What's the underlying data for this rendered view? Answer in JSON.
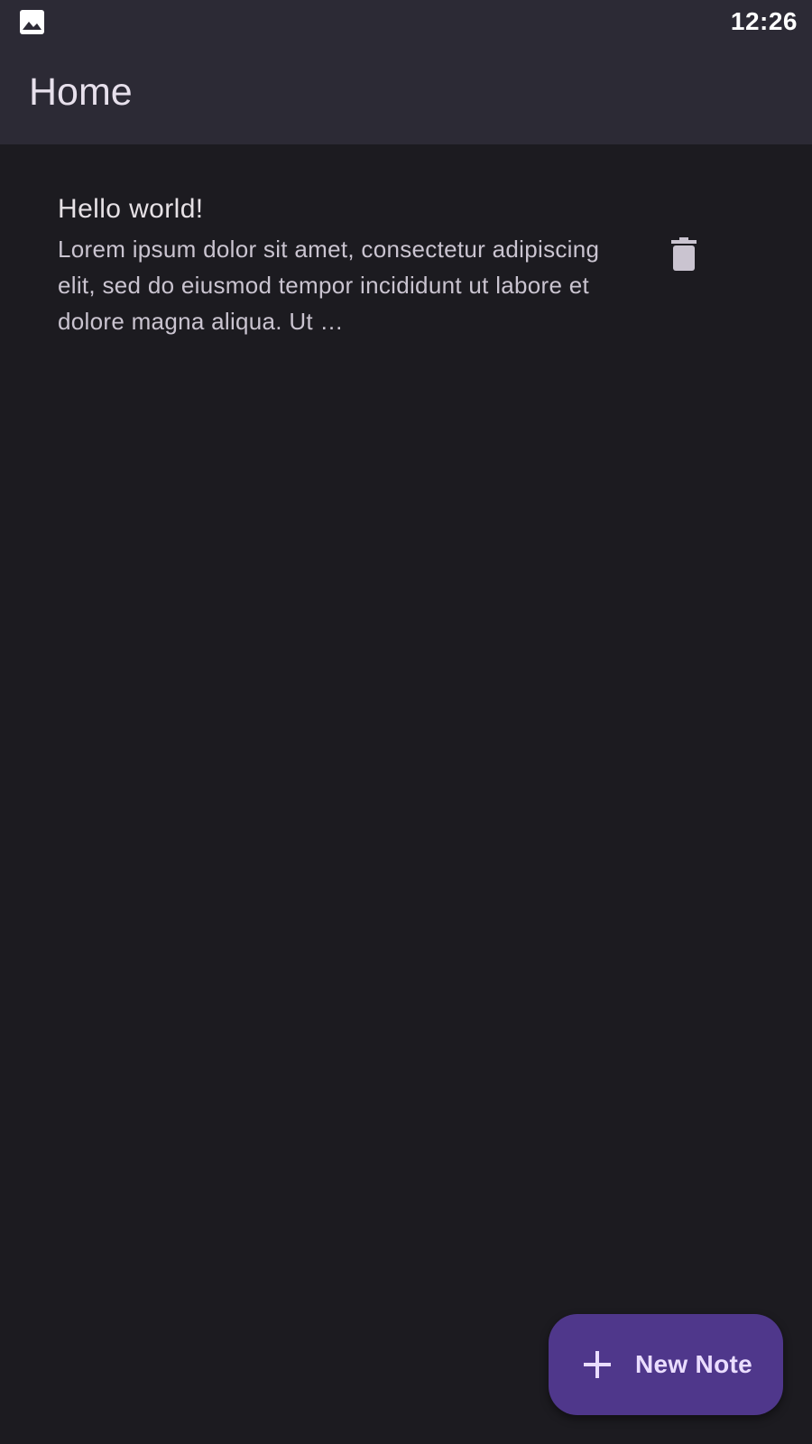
{
  "status_bar": {
    "time": "12:26",
    "notification_icon": "image-icon"
  },
  "app_bar": {
    "title": "Home"
  },
  "notes": [
    {
      "title": "Hello world!",
      "body": "Lorem ipsum dolor sit amet, consectetur adipiscing elit, sed do eiusmod tempor incididunt ut labore et dolore magna aliqua. Ut …",
      "action_icon": "trash-icon"
    }
  ],
  "fab": {
    "icon": "plus-icon",
    "label": "New Note"
  },
  "colors": {
    "background": "#1c1b20",
    "app_bar": "#2c2a35",
    "fab": "#4f378b",
    "fab_content": "#eaddff",
    "icon": "#cac4d0"
  }
}
